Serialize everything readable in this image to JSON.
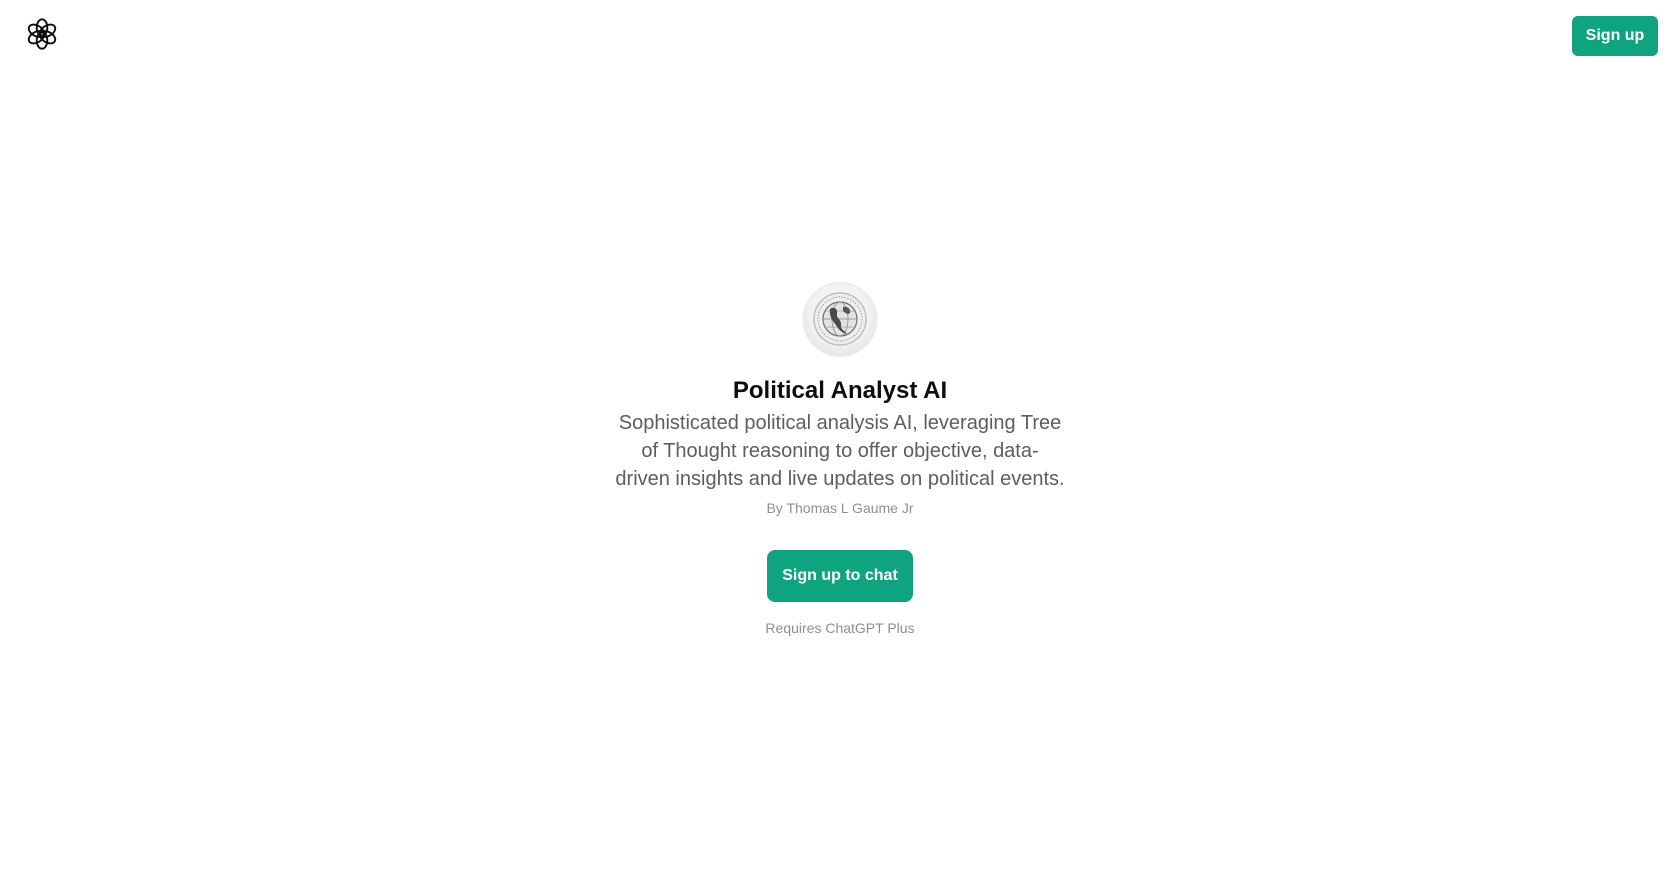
{
  "header": {
    "logo_icon": "openai-logo-icon",
    "signup_label": "Sign up"
  },
  "gpt": {
    "avatar_icon": "globe-coin-icon",
    "name": "Political Analyst AI",
    "description": "Sophisticated political analysis AI, leveraging Tree of Thought reasoning to offer objective, data-driven insights and live updates on political events.",
    "author": "By Thomas L Gaume Jr"
  },
  "cta": {
    "label": "Sign up to chat",
    "note": "Requires ChatGPT Plus"
  },
  "colors": {
    "accent": "#10a37f",
    "title": "#0d0d0d",
    "body_text": "#5d5d5d",
    "muted_text": "#8e8e8e"
  }
}
